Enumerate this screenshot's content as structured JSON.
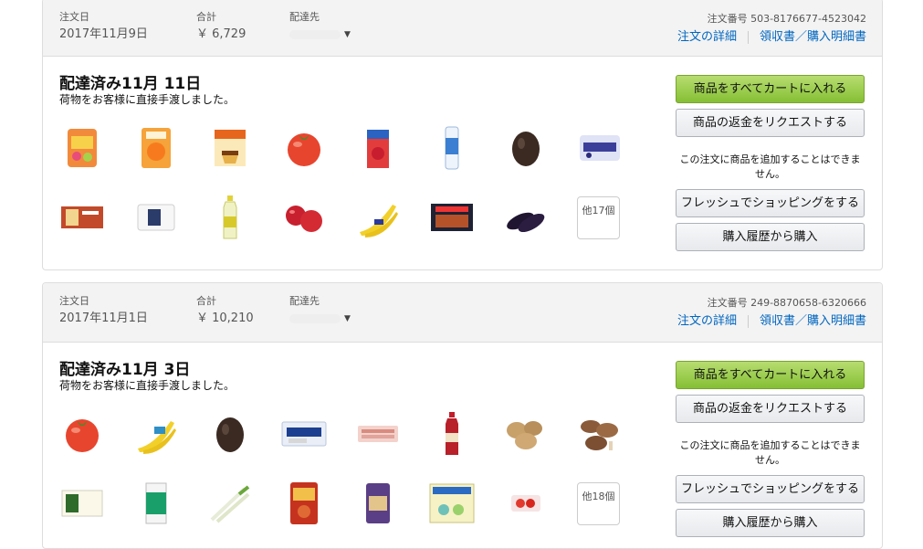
{
  "labels": {
    "order_date": "注文日",
    "total": "合計",
    "ship_to": "配達先",
    "order_number_prefix": "注文番号",
    "order_details": "注文の詳細",
    "receipt": "領収書／購入明細書",
    "delivered_note": "荷物をお客様に直接手渡しました。",
    "buy_again_all": "商品をすべてカートに入れる",
    "request_refund": "商品の返金をリクエストする",
    "cannot_add": "この注文に商品を追加することはできません。",
    "shop_fresh": "フレッシュでショッピングをする",
    "buy_from_history": "購入履歴から購入"
  },
  "orders": [
    {
      "date": "2017年11月9日",
      "total": "￥ 6,729",
      "order_number": "503-8176677-4523042",
      "status": "配達済み11月 11日",
      "more_count": "他17個",
      "items": [
        "candy-bag",
        "orange-jelly",
        "pudding",
        "tomato",
        "juice-box",
        "drink-bottle",
        "avocado",
        "blueberry-snack",
        "rice-cracker",
        "bread-loaf",
        "soda-bottle",
        "apples",
        "bananas",
        "frozen-karaage",
        "eggplants"
      ]
    },
    {
      "date": "2017年11月1日",
      "total": "￥ 10,210",
      "order_number": "249-8870658-6320666",
      "status": "配達済み11月 3日",
      "more_count": "他18個",
      "items": [
        "tomato",
        "bananas",
        "avocado",
        "cream-cheese",
        "bacon-pack",
        "tea-bottle",
        "potatoes",
        "shiitake",
        "tofu",
        "yogurt-drink",
        "green-onion",
        "nabe-soup",
        "bread-bag",
        "yakult-pack",
        "cherry-tomatoes"
      ]
    }
  ],
  "colors": {
    "link": "#0066c0",
    "primary_button": "#a4d35a",
    "header_bg": "#f3f3f3"
  }
}
